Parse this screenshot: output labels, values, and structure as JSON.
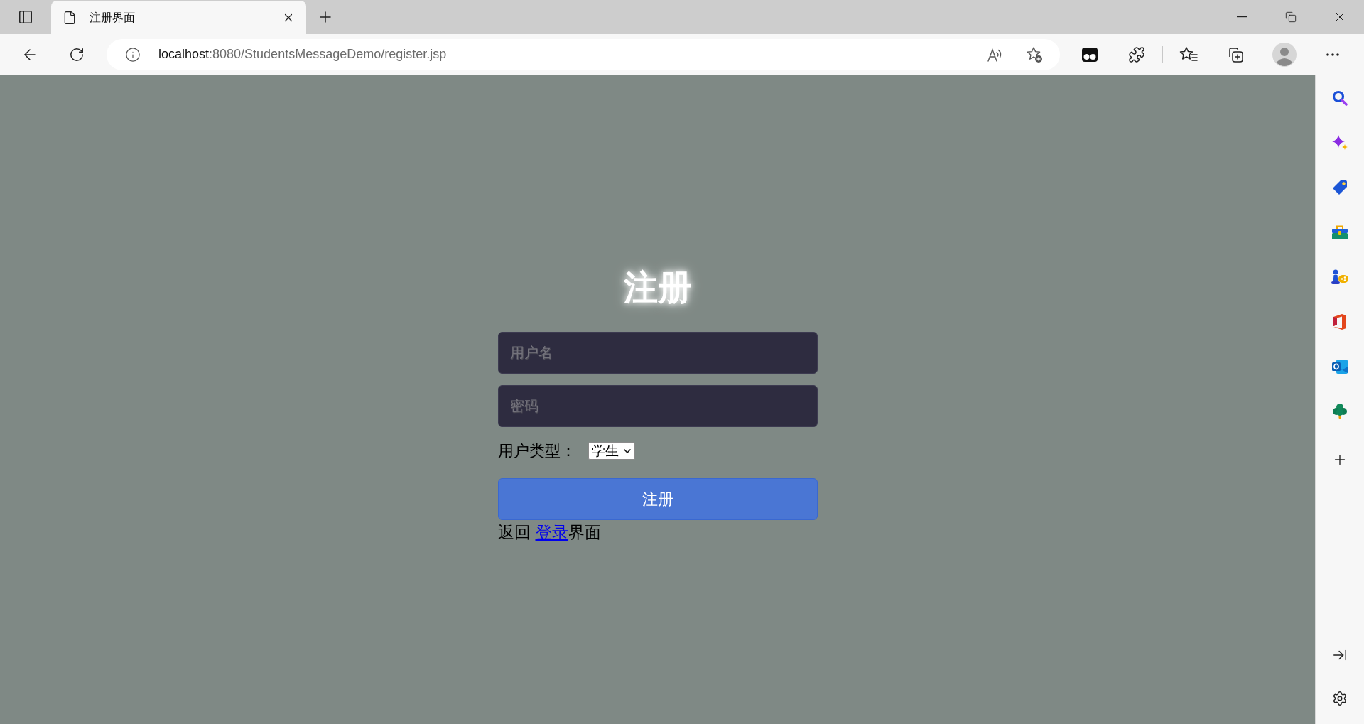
{
  "browser": {
    "tabs": [
      {
        "title": "注册界面",
        "selected": true
      }
    ],
    "address": {
      "host": "localhost",
      "path": ":8080/StudentsMessageDemo/register.jsp"
    }
  },
  "form": {
    "title": "注册",
    "fields": [
      {
        "placeholder": "用户名"
      },
      {
        "placeholder": "密码"
      }
    ],
    "user_type": {
      "label": "用户类型：",
      "value": "学生"
    },
    "submit": "注册",
    "footer": {
      "text_before": "返回",
      "link": "登录",
      "text_after": "界面"
    }
  }
}
